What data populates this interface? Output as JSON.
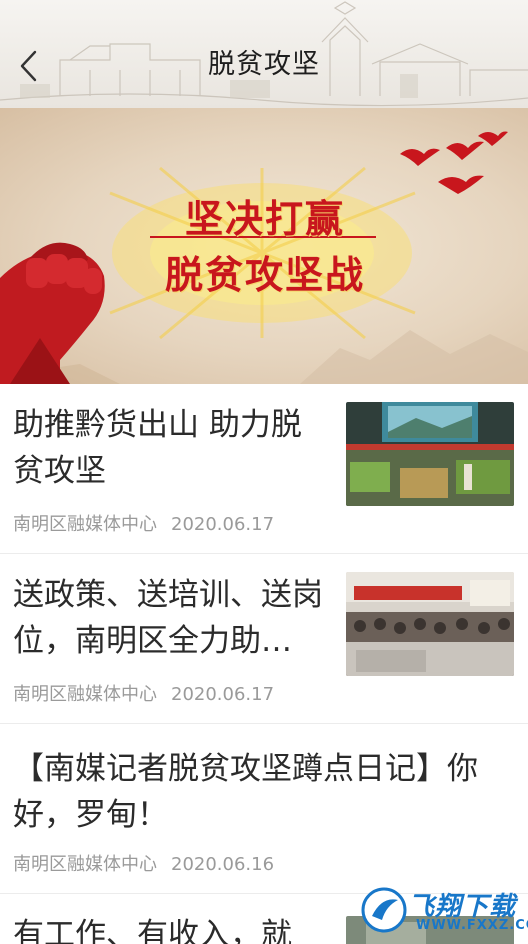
{
  "header": {
    "title": "脱贫攻坚",
    "back_icon": "chevron-left-icon"
  },
  "banner": {
    "line1": "坚决打赢",
    "line2": "脱贫攻坚战",
    "accent_color": "#c8161d"
  },
  "news": [
    {
      "title": "助推黔货出山  助力脱贫攻坚",
      "source": "南明区融媒体中心",
      "date": "2020.06.17",
      "has_thumb": true
    },
    {
      "title": "送政策、送培训、送岗位，南明区全力助…",
      "source": "南明区融媒体中心",
      "date": "2020.06.17",
      "has_thumb": true
    },
    {
      "title": "【南媒记者脱贫攻坚蹲点日记】你好，罗甸！",
      "source": "南明区融媒体中心",
      "date": "2020.06.16",
      "has_thumb": false
    },
    {
      "title": "有工作、有收入，就",
      "has_thumb": true
    }
  ],
  "watermark": {
    "text": "飞翔下载",
    "url": "WWW.FXXZ.COM"
  }
}
